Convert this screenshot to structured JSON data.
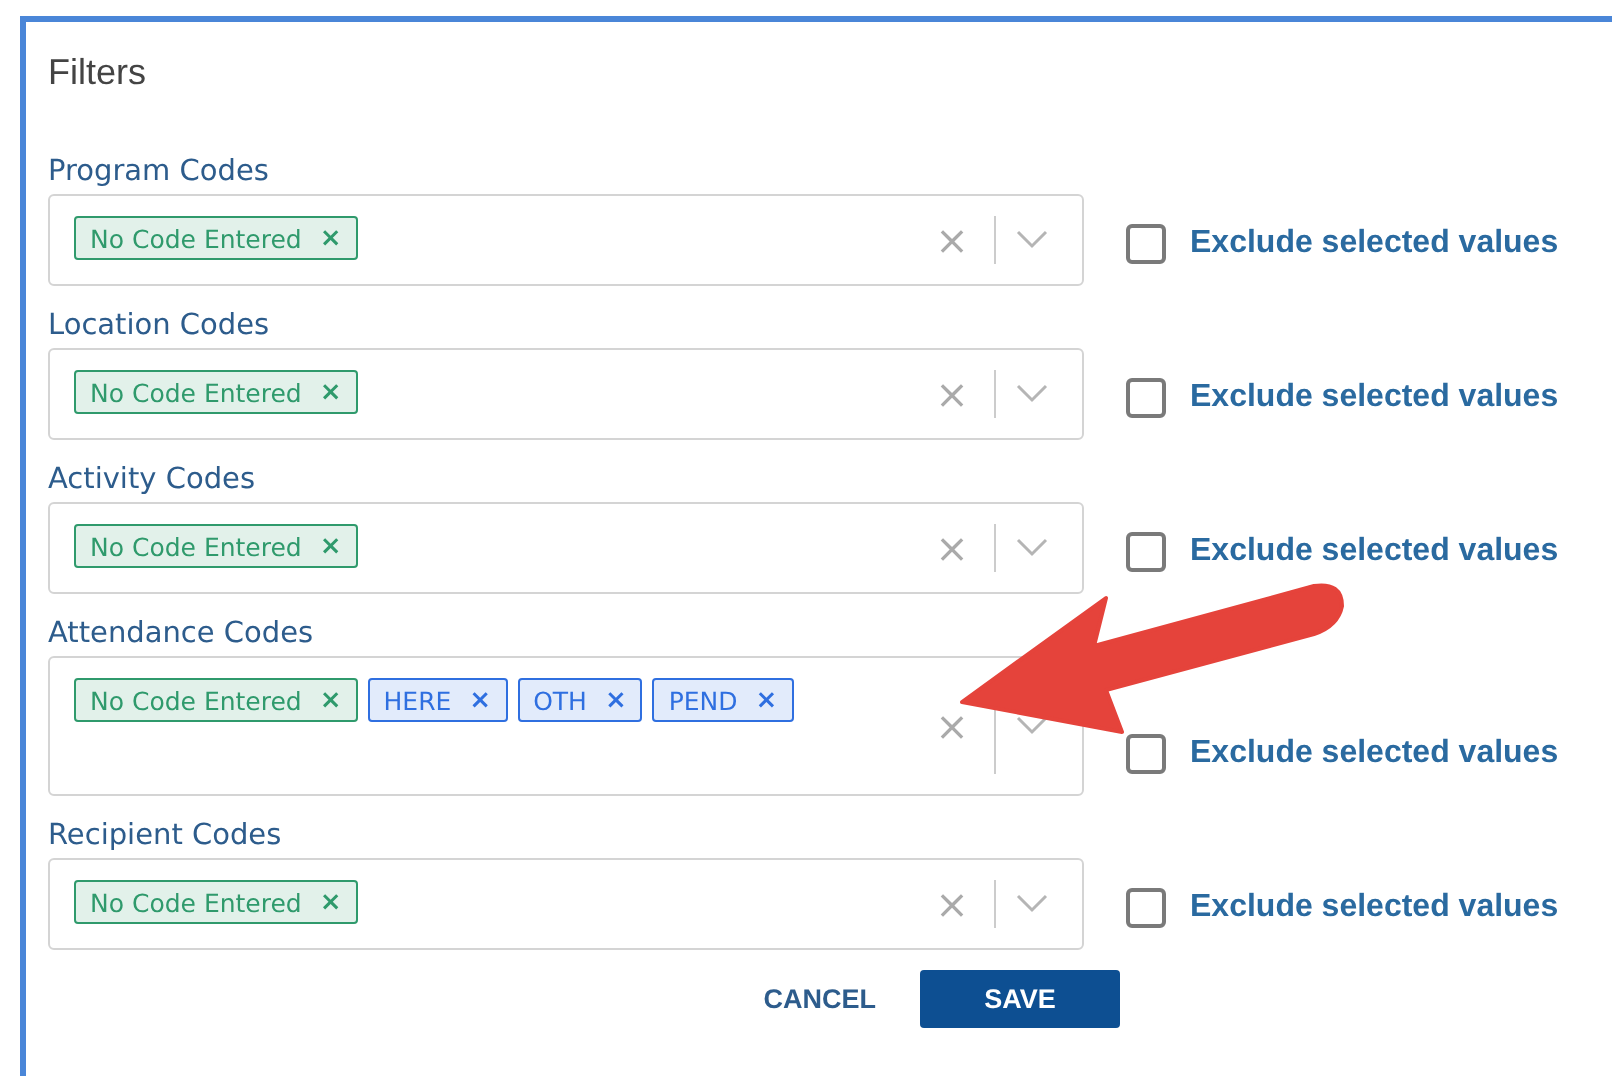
{
  "title": "Filters",
  "filters": [
    {
      "label": "Program Codes",
      "tags": [
        {
          "text": "No Code Entered",
          "remove": "×",
          "color": "#2f9a6c"
        }
      ],
      "clear": "×",
      "exclude": {
        "label": "Exclude selected values",
        "checked": false
      }
    },
    {
      "label": "Location Codes",
      "tags": [
        {
          "text": "No Code Entered",
          "remove": "×",
          "color": "#2f9a6c"
        }
      ],
      "clear": "×",
      "exclude": {
        "label": "Exclude selected values",
        "checked": false
      }
    },
    {
      "label": "Activity Codes",
      "tags": [
        {
          "text": "No Code Entered",
          "remove": "×",
          "color": "#2f9a6c"
        }
      ],
      "clear": "×",
      "exclude": {
        "label": "Exclude selected values",
        "checked": false
      }
    },
    {
      "label": "Attendance Codes",
      "tags": [
        {
          "text": "No Code Entered",
          "remove": "×",
          "color": "#2f9a6c"
        },
        {
          "text": "HERE",
          "remove": "×",
          "color": "#2f6fe0"
        },
        {
          "text": "OTH",
          "remove": "×",
          "color": "#2f6fe0"
        },
        {
          "text": "PEND",
          "remove": "×",
          "color": "#2f6fe0"
        }
      ],
      "clear": "×",
      "exclude": {
        "label": "Exclude selected values",
        "checked": false
      }
    },
    {
      "label": "Recipient Codes",
      "tags": [
        {
          "text": "No Code Entered",
          "remove": "×",
          "color": "#2f9a6c"
        }
      ],
      "clear": "×",
      "exclude": {
        "label": "Exclude selected values",
        "checked": false
      }
    }
  ],
  "buttons": [
    {
      "label": "CANCEL",
      "kind": "secondary"
    },
    {
      "label": "SAVE",
      "kind": "primary"
    }
  ]
}
